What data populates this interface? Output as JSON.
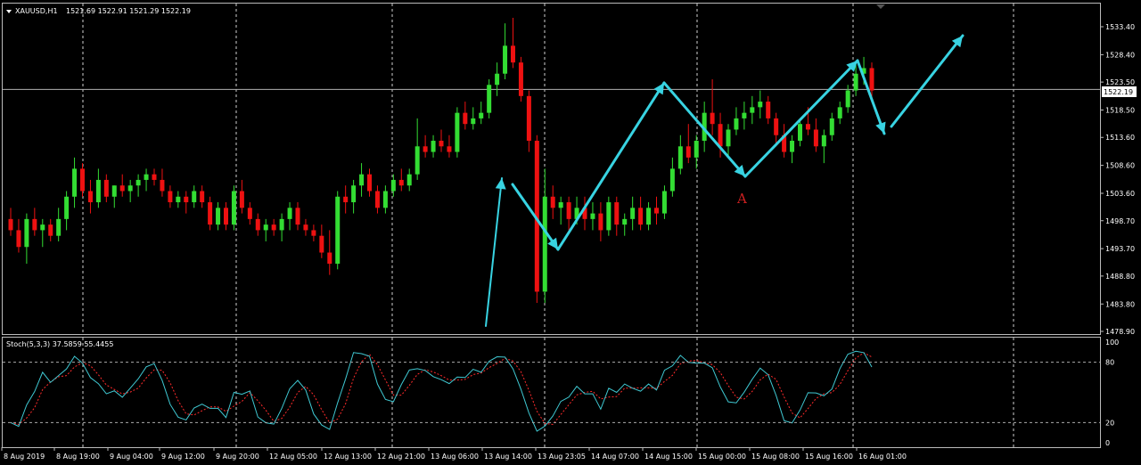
{
  "header": {
    "symbol": "XAUUSD,H1",
    "ohlc": "1521.69 1522.91 1521.29 1522.19",
    "dropdown_icon": "triangle-down-icon"
  },
  "indicator": {
    "label": "Stoch(5,3,3) 37.5859 55.4455",
    "levels": [
      100,
      80,
      20,
      0
    ],
    "level_labels": [
      "100",
      "80",
      "20",
      "0"
    ],
    "main_color": "#3fc8d2",
    "signal_color": "#ff2b2b"
  },
  "annotation": {
    "label": "A",
    "color": "#cc2020"
  },
  "colors": {
    "bull": "#33dd33",
    "bear": "#ee1111",
    "grid": "#cfcfcf",
    "arrow": "#38d3e2",
    "price_line": "#b0b0b0"
  },
  "chart_data": {
    "type": "candlestick",
    "symbol": "XAUUSD",
    "timeframe": "H1",
    "ylim": [
      1478.9,
      1536.0
    ],
    "y_ticks": [
      1533.4,
      1528.4,
      1523.5,
      1518.5,
      1513.6,
      1508.6,
      1503.6,
      1498.7,
      1493.7,
      1488.8,
      1483.8,
      1478.9
    ],
    "y_tick_labels": [
      "1533.40",
      "1528.40",
      "1523.50",
      "1518.50",
      "1513.60",
      "1508.60",
      "1503.60",
      "1498.70",
      "1493.70",
      "1488.80",
      "1483.80",
      "1478.90"
    ],
    "current_price": 1522.19,
    "current_price_label": "1522.19",
    "x_tick_labels": [
      "8 Aug 2019",
      "8 Aug 19:00",
      "9 Aug 04:00",
      "9 Aug 12:00",
      "9 Aug 20:00",
      "12 Aug 05:00",
      "12 Aug 13:00",
      "12 Aug 21:00",
      "13 Aug 06:00",
      "13 Aug 14:00",
      "13 Aug 23:05",
      "14 Aug 07:00",
      "14 Aug 15:00",
      "15 Aug 00:00",
      "15 Aug 08:00",
      "15 Aug 16:00",
      "16 Aug 01:00"
    ],
    "candles": [
      [
        1499,
        1501,
        1496,
        1497
      ],
      [
        1497,
        1499,
        1493,
        1494
      ],
      [
        1494,
        1500,
        1491,
        1499
      ],
      [
        1499,
        1501,
        1496,
        1497
      ],
      [
        1497,
        1499,
        1494,
        1498
      ],
      [
        1498,
        1499,
        1495,
        1496
      ],
      [
        1496,
        1501,
        1495,
        1499
      ],
      [
        1499,
        1504,
        1497,
        1503
      ],
      [
        1503,
        1510,
        1501,
        1508
      ],
      [
        1508,
        1509,
        1503,
        1504
      ],
      [
        1504,
        1506,
        1500,
        1502
      ],
      [
        1502,
        1508,
        1501,
        1506
      ],
      [
        1506,
        1507,
        1502,
        1503
      ],
      [
        1503,
        1505,
        1501,
        1505
      ],
      [
        1505,
        1507,
        1503,
        1504
      ],
      [
        1504,
        1506,
        1502,
        1505
      ],
      [
        1505,
        1507,
        1503,
        1506
      ],
      [
        1506,
        1508,
        1504,
        1507
      ],
      [
        1507,
        1508,
        1505,
        1506
      ],
      [
        1506,
        1508,
        1503,
        1504
      ],
      [
        1504,
        1505,
        1501,
        1502
      ],
      [
        1502,
        1504,
        1501,
        1503
      ],
      [
        1503,
        1504,
        1500,
        1502
      ],
      [
        1502,
        1505,
        1501,
        1504
      ],
      [
        1504,
        1505,
        1501,
        1502
      ],
      [
        1502,
        1503,
        1497,
        1498
      ],
      [
        1498,
        1502,
        1497,
        1501
      ],
      [
        1501,
        1502,
        1497,
        1498
      ],
      [
        1498,
        1505,
        1497,
        1504
      ],
      [
        1504,
        1506,
        1500,
        1501
      ],
      [
        1501,
        1502,
        1498,
        1499
      ],
      [
        1499,
        1500,
        1496,
        1497
      ],
      [
        1497,
        1499,
        1495,
        1498
      ],
      [
        1498,
        1499,
        1496,
        1497
      ],
      [
        1497,
        1500,
        1495,
        1499
      ],
      [
        1499,
        1502,
        1497,
        1501
      ],
      [
        1501,
        1502,
        1497,
        1498
      ],
      [
        1498,
        1499,
        1496,
        1497
      ],
      [
        1497,
        1498,
        1495,
        1496
      ],
      [
        1496,
        1498,
        1492,
        1493
      ],
      [
        1493,
        1497,
        1489,
        1491
      ],
      [
        1491,
        1504,
        1490,
        1503
      ],
      [
        1503,
        1505,
        1500,
        1502
      ],
      [
        1502,
        1506,
        1500,
        1505
      ],
      [
        1505,
        1509,
        1503,
        1507
      ],
      [
        1507,
        1508,
        1503,
        1504
      ],
      [
        1504,
        1505,
        1500,
        1501
      ],
      [
        1501,
        1505,
        1500,
        1504
      ],
      [
        1504,
        1507,
        1503,
        1506
      ],
      [
        1506,
        1508,
        1504,
        1505
      ],
      [
        1505,
        1508,
        1504,
        1507
      ],
      [
        1507,
        1517,
        1506,
        1512
      ],
      [
        1512,
        1514,
        1510,
        1511
      ],
      [
        1511,
        1514,
        1510,
        1513
      ],
      [
        1513,
        1515,
        1511,
        1512
      ],
      [
        1512,
        1514,
        1510,
        1511
      ],
      [
        1511,
        1519,
        1510,
        1518
      ],
      [
        1518,
        1520,
        1515,
        1516
      ],
      [
        1516,
        1519,
        1515,
        1517
      ],
      [
        1517,
        1520,
        1516,
        1518
      ],
      [
        1518,
        1524,
        1517,
        1523
      ],
      [
        1523,
        1527,
        1521,
        1525
      ],
      [
        1525,
        1534,
        1524,
        1530
      ],
      [
        1530,
        1535,
        1526,
        1527
      ],
      [
        1527,
        1528,
        1520,
        1521
      ],
      [
        1521,
        1522,
        1511,
        1513
      ],
      [
        1513,
        1514,
        1484,
        1486
      ],
      [
        1486,
        1508,
        1484,
        1503
      ],
      [
        1503,
        1505,
        1499,
        1501
      ],
      [
        1501,
        1503,
        1498,
        1502
      ],
      [
        1502,
        1503,
        1497,
        1499
      ],
      [
        1499,
        1503,
        1498,
        1501
      ],
      [
        1501,
        1503,
        1497,
        1499
      ],
      [
        1499,
        1502,
        1497,
        1500
      ],
      [
        1500,
        1502,
        1495,
        1497
      ],
      [
        1497,
        1503,
        1496,
        1502
      ],
      [
        1502,
        1503,
        1496,
        1498
      ],
      [
        1498,
        1500,
        1496,
        1499
      ],
      [
        1499,
        1503,
        1497,
        1501
      ],
      [
        1501,
        1503,
        1497,
        1498
      ],
      [
        1498,
        1502,
        1497,
        1501
      ],
      [
        1501,
        1503,
        1498,
        1500
      ],
      [
        1500,
        1505,
        1499,
        1504
      ],
      [
        1504,
        1510,
        1503,
        1508
      ],
      [
        1508,
        1514,
        1507,
        1512
      ],
      [
        1512,
        1516,
        1509,
        1510
      ],
      [
        1510,
        1514,
        1508,
        1513
      ],
      [
        1513,
        1520,
        1511,
        1518
      ],
      [
        1518,
        1524,
        1514,
        1516
      ],
      [
        1516,
        1518,
        1510,
        1512
      ],
      [
        1512,
        1516,
        1510,
        1515
      ],
      [
        1515,
        1519,
        1514,
        1517
      ],
      [
        1517,
        1520,
        1515,
        1518
      ],
      [
        1518,
        1521,
        1516,
        1519
      ],
      [
        1519,
        1522,
        1517,
        1520
      ],
      [
        1520,
        1521,
        1516,
        1517
      ],
      [
        1517,
        1518,
        1512,
        1514
      ],
      [
        1514,
        1516,
        1510,
        1511
      ],
      [
        1511,
        1514,
        1509,
        1513
      ],
      [
        1513,
        1517,
        1512,
        1516
      ],
      [
        1516,
        1519,
        1514,
        1515
      ],
      [
        1515,
        1517,
        1511,
        1512
      ],
      [
        1512,
        1515,
        1509,
        1514
      ],
      [
        1514,
        1518,
        1513,
        1517
      ],
      [
        1517,
        1520,
        1516,
        1519
      ],
      [
        1519,
        1523,
        1518,
        1522
      ],
      [
        1522,
        1527,
        1521,
        1525
      ],
      [
        1525,
        1528,
        1523,
        1526
      ],
      [
        1526,
        1527,
        1520,
        1522
      ]
    ]
  }
}
